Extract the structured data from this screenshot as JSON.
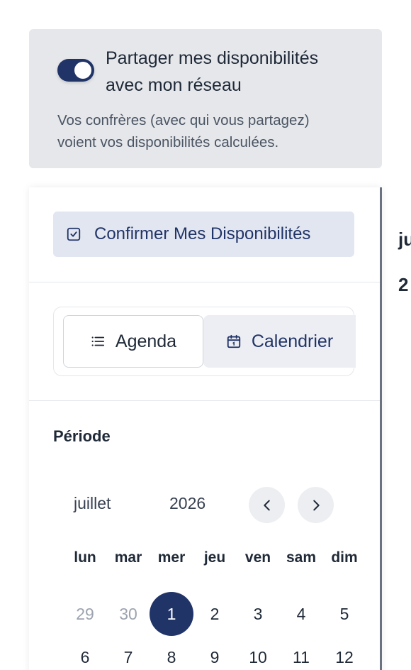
{
  "share": {
    "title_line1": "Partager mes disponibilités",
    "title_line2": "avec mon réseau",
    "desc_line1": "Vos confrères (avec qui vous partagez)",
    "desc_line2": "voient vos disponibilités calculées.",
    "toggle_on": true
  },
  "edge": {
    "frag1": "ju",
    "frag2": "2"
  },
  "panel": {
    "confirm_label": "Confirmer Mes Disponibilités",
    "views": {
      "agenda": "Agenda",
      "calendar": "Calendrier",
      "selected": "calendar"
    },
    "period_label": "Période",
    "calendar": {
      "month": "juillet",
      "year": "2026",
      "weekdays": [
        "lun",
        "mar",
        "mer",
        "jeu",
        "ven",
        "sam",
        "dim"
      ],
      "rows": [
        [
          {
            "d": "29",
            "m": true
          },
          {
            "d": "30",
            "m": true
          },
          {
            "d": "1",
            "s": true
          },
          {
            "d": "2"
          },
          {
            "d": "3"
          },
          {
            "d": "4"
          },
          {
            "d": "5"
          }
        ],
        [
          {
            "d": "6"
          },
          {
            "d": "7"
          },
          {
            "d": "8"
          },
          {
            "d": "9"
          },
          {
            "d": "10"
          },
          {
            "d": "11"
          },
          {
            "d": "12"
          }
        ]
      ]
    }
  },
  "colors": {
    "accent": "#213468",
    "card_bg": "#e5e7eb",
    "button_bg": "#e2e6f0"
  },
  "icons": {
    "confirm": "checkbox-check-icon",
    "agenda": "list-icon",
    "calendar": "calendar-icon",
    "prev": "chevron-left-icon",
    "next": "chevron-right-icon"
  }
}
